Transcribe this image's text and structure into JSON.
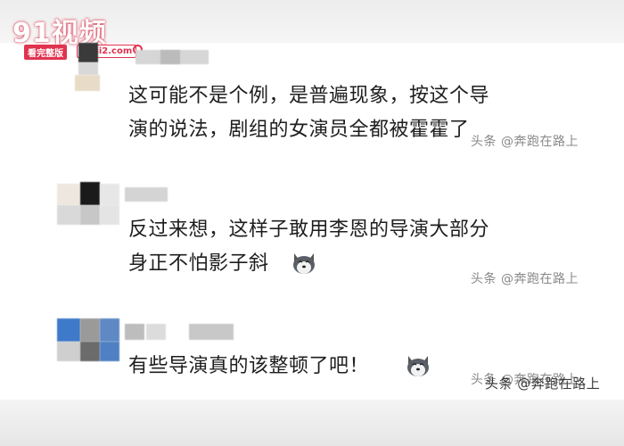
{
  "logo": {
    "main": "91视频",
    "badge_left": "看完整版",
    "badge_right": "91si2.com"
  },
  "comments": [
    {
      "line1": "这可能不是个例，是普遍现象，按这个导",
      "line2": "演的说法，剧组的女演员全都被霍霍了",
      "watermark": "头条 @奔跑在路上"
    },
    {
      "line1": "反过来想，这样子敢用李恩的导演大部分",
      "line2": "身正不怕影子斜",
      "watermark": "头条 @奔跑在路上"
    },
    {
      "line1": "有些导演真的该整顿了吧！",
      "watermark": "头条 @奔跑在路上",
      "watermark_overlay": "头条 @奔跑在路上"
    }
  ],
  "icons": {
    "emoji": "husky-dog-emoji-icon",
    "search": "search-icon"
  },
  "colors": {
    "brand": "#e0334f",
    "text": "#1e1e1e",
    "watermark": "#888888"
  }
}
